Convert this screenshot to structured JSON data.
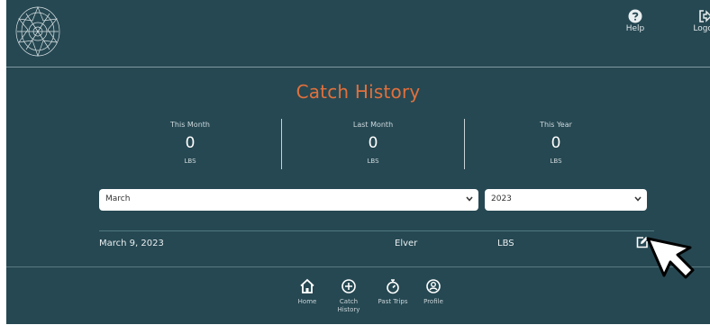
{
  "header": {
    "help_label": "Help",
    "logout_label": "Logou"
  },
  "title": "Catch History",
  "stats": [
    {
      "label": "This Month",
      "value": "0",
      "unit": "LBS"
    },
    {
      "label": "Last Month",
      "value": "0",
      "unit": "LBS"
    },
    {
      "label": "This Year",
      "value": "0",
      "unit": "LBS"
    }
  ],
  "filters": {
    "month_selected": "March",
    "year_selected": "2023"
  },
  "catches": [
    {
      "date": "March 9, 2023",
      "species": "Elver",
      "weight_unit": "LBS"
    }
  ],
  "nav": {
    "home": "Home",
    "catch_history_line1": "Catch",
    "catch_history_line2": "History",
    "past_trips": "Past Trips",
    "profile": "Profile"
  },
  "colors": {
    "background": "#264852",
    "title_accent": "#e2703c",
    "text": "#ffffff"
  },
  "icons": [
    "logo-emblem",
    "help-icon",
    "logout-icon",
    "chevron-down-icon",
    "edit-icon",
    "home-icon",
    "plus-circle-icon",
    "stopwatch-icon",
    "profile-icon",
    "mouse-cursor"
  ]
}
